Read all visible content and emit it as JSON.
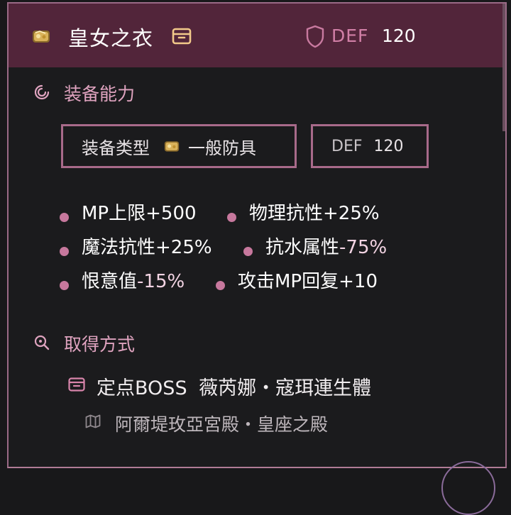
{
  "header": {
    "title": "皇女之衣",
    "def_label": "DEF",
    "def_value": "120",
    "item_icon": "treasure-item-icon",
    "box_icon": "box-icon",
    "shield_icon": "shield-icon"
  },
  "ability": {
    "title": "装备能力",
    "icon": "swirl-icon",
    "type_label": "装备类型",
    "type_value": "一般防具",
    "def_label": "DEF",
    "def_value": "120",
    "stats": [
      {
        "text": "MP上限+500"
      },
      {
        "text": "物理抗性+25%"
      },
      {
        "text": "魔法抗性+25%"
      },
      {
        "text": "抗水属性",
        "neg": "-75%"
      },
      {
        "text": "恨意值",
        "neg": "-15%"
      },
      {
        "text": "攻击MP回复+10"
      }
    ]
  },
  "acquire": {
    "title": "取得方式",
    "icon": "search-icon",
    "source_label": "定点BOSS",
    "source_name": "薇芮娜・寇珥連生體",
    "location": "阿爾堤玫亞宮殿・皇座之殿",
    "source_icon": "mail-icon",
    "location_icon": "map-icon"
  },
  "colors": {
    "header_bg": "#52253a",
    "accent": "#c7789d",
    "border": "#a86a8a"
  }
}
